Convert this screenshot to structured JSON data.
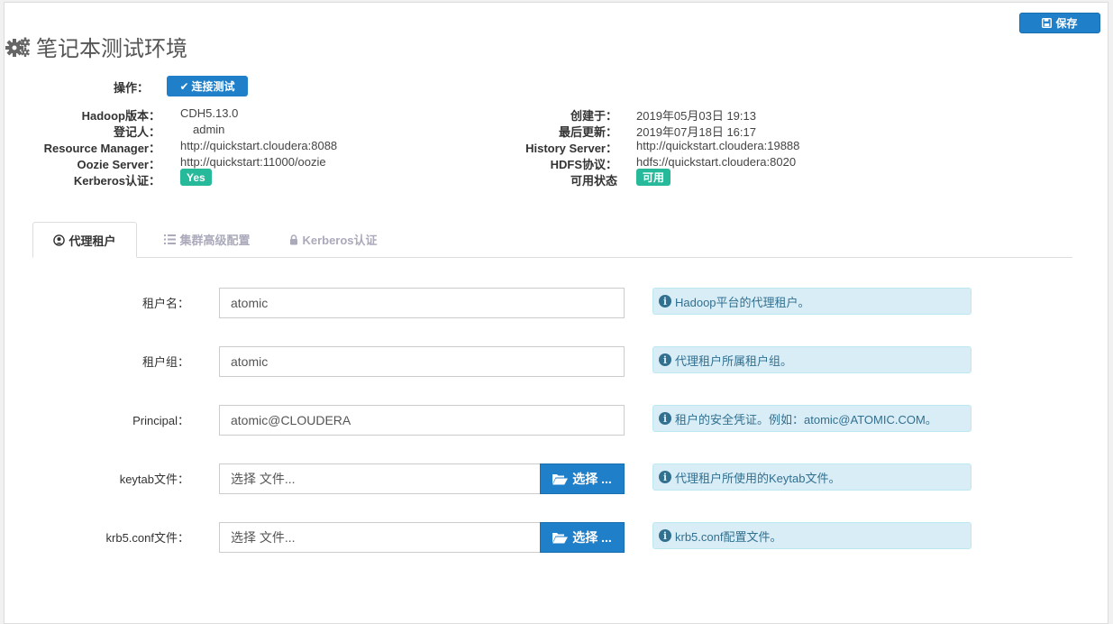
{
  "header": {
    "title": "笔记本测试环境",
    "save_label": "保存"
  },
  "operations": {
    "label": "操作：",
    "test_button": "连接测试"
  },
  "info_left": [
    {
      "label": "Hadoop版本：",
      "value": "CDH5.13.0"
    },
    {
      "label": "登记人：",
      "value": "admin"
    },
    {
      "label": "Resource Manager：",
      "value": "http://quickstart.cloudera:8088"
    },
    {
      "label": "Oozie Server：",
      "value": "http://quickstart:11000/oozie"
    },
    {
      "label": "Kerberos认证：",
      "value": "Yes"
    }
  ],
  "info_right": [
    {
      "label": "创建于：",
      "value": "2019年05月03日 19:13"
    },
    {
      "label": "最后更新：",
      "value": "2019年07月18日 16:17"
    },
    {
      "label": "History Server：",
      "value": "http://quickstart.cloudera:19888"
    },
    {
      "label": "HDFS协议：",
      "value": "hdfs://quickstart.cloudera:8020"
    },
    {
      "label": "可用状态",
      "value": "可用"
    }
  ],
  "tabs": [
    {
      "label": "代理租户",
      "icon": "user-circle-icon"
    },
    {
      "label": "集群高级配置",
      "icon": "list-icon"
    },
    {
      "label": "Kerberos认证",
      "icon": "lock-icon"
    }
  ],
  "form": {
    "tenant_name": {
      "label": "租户名：",
      "value": "atomic",
      "help": "Hadoop平台的代理租户。"
    },
    "tenant_group": {
      "label": "租户组：",
      "value": "atomic",
      "help": "代理租户所属租户组。"
    },
    "principal": {
      "label": "Principal：",
      "value": "atomic@CLOUDERA",
      "help": "租户的安全凭证。例如：atomic@ATOMIC.COM。"
    },
    "keytab": {
      "label": "keytab文件：",
      "placeholder": "选择 文件...",
      "button": "选择 ...",
      "help": "代理租户所使用的Keytab文件。"
    },
    "krb5": {
      "label": "krb5.conf文件：",
      "placeholder": "选择 文件...",
      "button": "选择 ...",
      "help": "krb5.conf配置文件。"
    }
  },
  "colors": {
    "primary": "#1f7fc9",
    "success": "#26b99a",
    "info_bg": "#d9edf7",
    "info_text": "#31708f"
  }
}
